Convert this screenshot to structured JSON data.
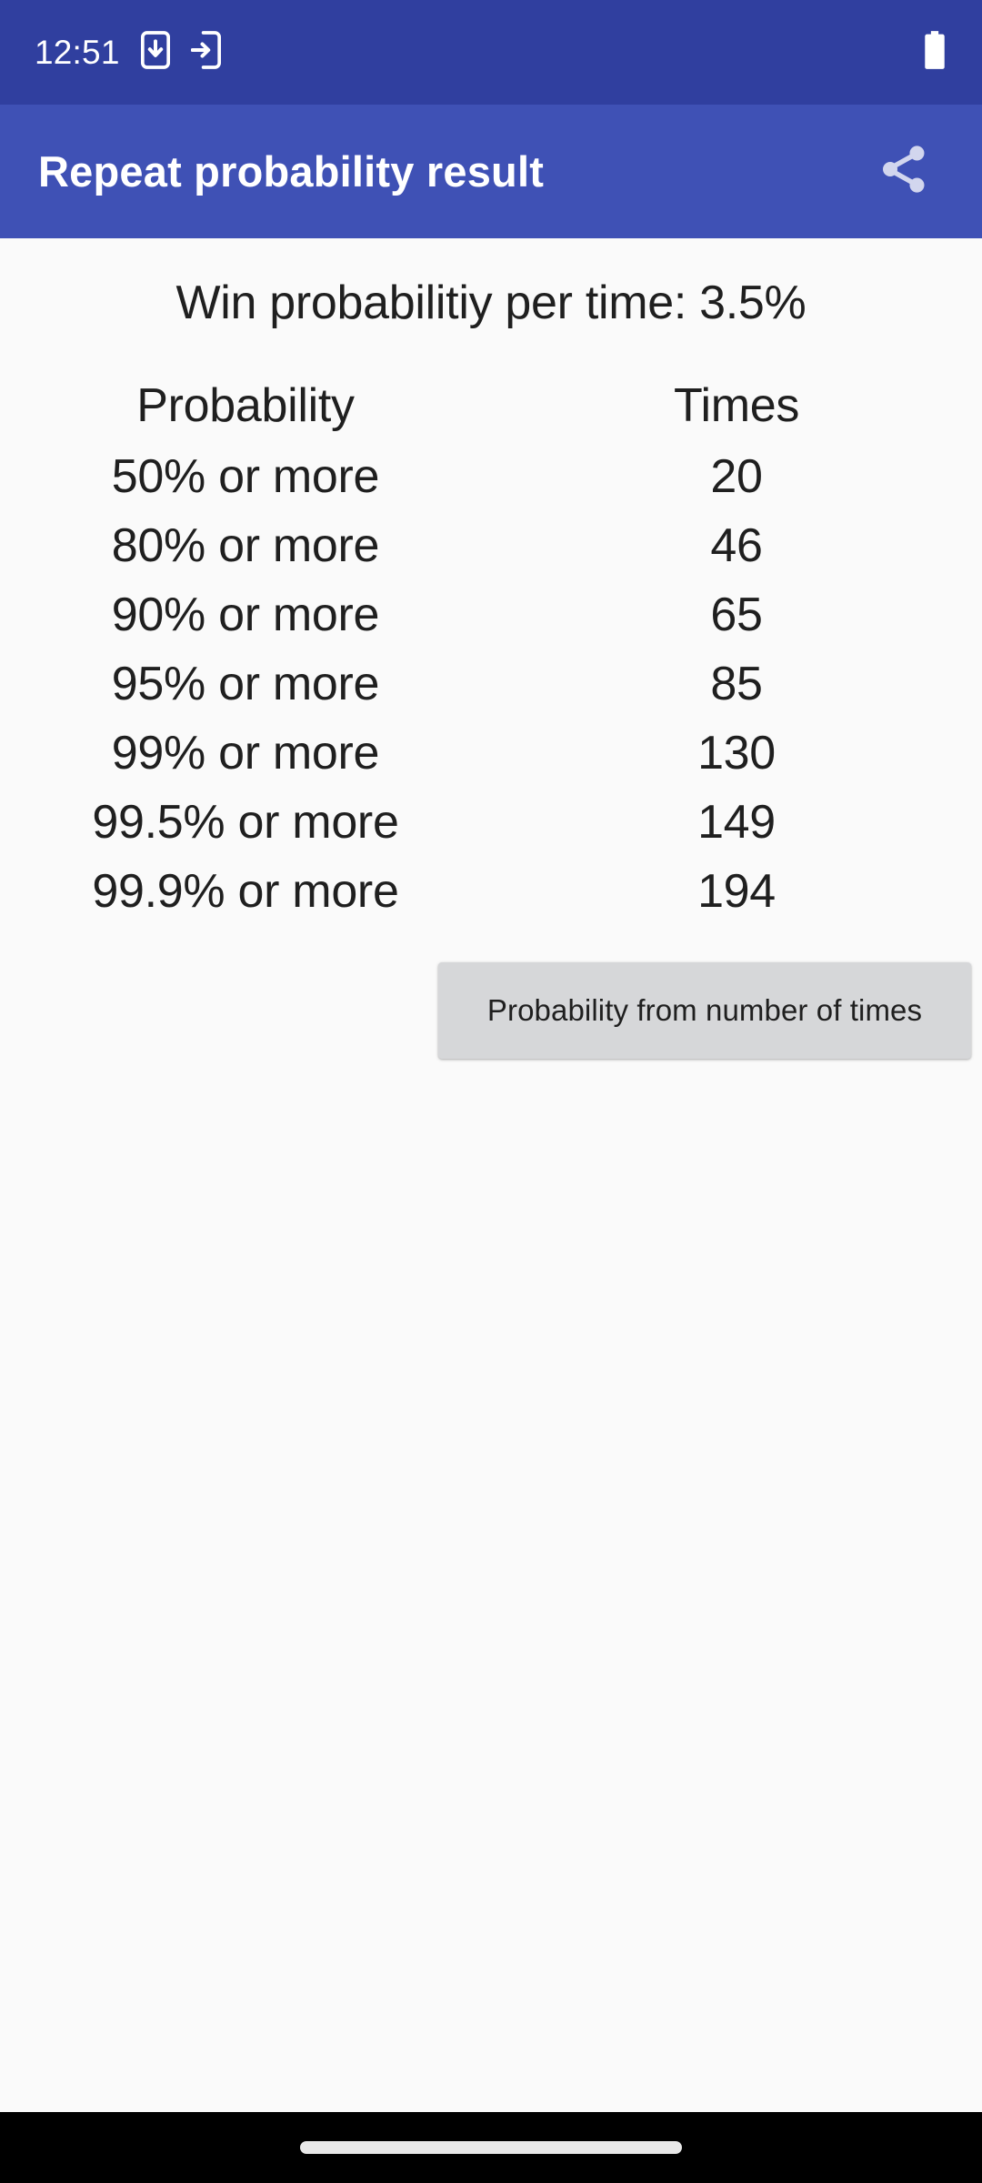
{
  "status_bar": {
    "time": "12:51",
    "background_color": "#303f9f",
    "icons": [
      {
        "name": "phone-download-icon"
      },
      {
        "name": "phone-cast-in-icon"
      }
    ],
    "battery": {
      "name": "battery-full-icon",
      "level": "full"
    }
  },
  "app_bar": {
    "title": "Repeat probability result",
    "background_color": "#3f51b5",
    "title_color": "#ffffff",
    "share_action_label": "Share"
  },
  "content": {
    "headline": "Win probabilitiy per time: 3.5%",
    "background_color": "#fafafa",
    "text_color": "#1f1f1f"
  },
  "table": {
    "headers": [
      "Probability",
      "Times"
    ],
    "rows": [
      {
        "probability": "50% or more",
        "times": "20"
      },
      {
        "probability": "80% or more",
        "times": "46"
      },
      {
        "probability": "90% or more",
        "times": "65"
      },
      {
        "probability": "95% or more",
        "times": "85"
      },
      {
        "probability": "99% or more",
        "times": "130"
      },
      {
        "probability": "99.5% or more",
        "times": "149"
      },
      {
        "probability": "99.9% or more",
        "times": "194"
      }
    ]
  },
  "actions": {
    "probability_from_times_label": "Probability from number of times",
    "button_background": "#d6d7d9"
  },
  "nav_bar": {
    "background_color": "#000000",
    "gesture_pill_color": "#e8e8e8"
  }
}
